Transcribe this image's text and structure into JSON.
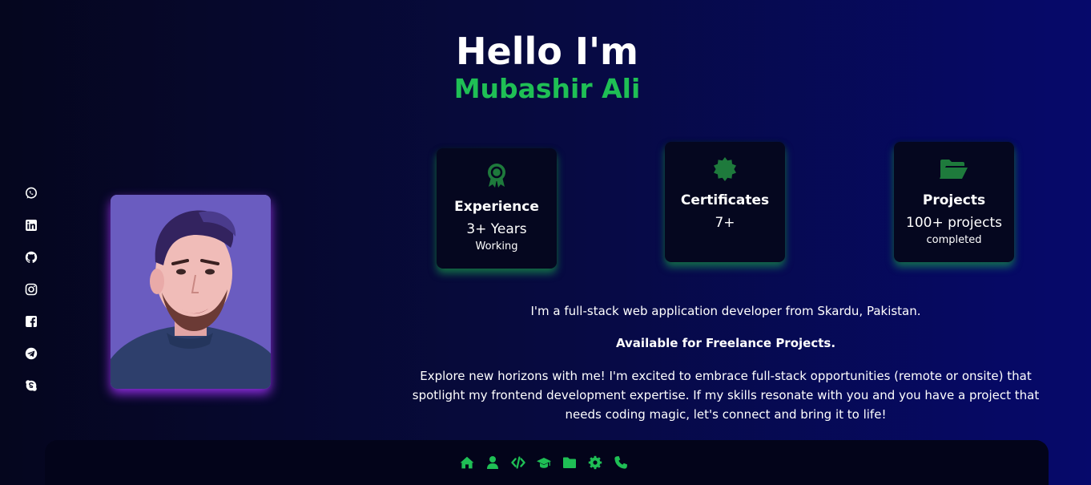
{
  "hero": {
    "greeting": "Hello I'm",
    "name": "Mubashir Ali"
  },
  "social_links": [
    {
      "icon": "whatsapp-icon"
    },
    {
      "icon": "linkedin-icon"
    },
    {
      "icon": "github-icon"
    },
    {
      "icon": "instagram-icon"
    },
    {
      "icon": "facebook-icon"
    },
    {
      "icon": "telegram-icon"
    },
    {
      "icon": "skype-icon"
    }
  ],
  "stats": [
    {
      "icon": "award-icon",
      "title": "Experience",
      "value": "3+ Years",
      "sub": "Working"
    },
    {
      "icon": "certificate-icon",
      "title": "Certificates",
      "value": "7+",
      "sub": ""
    },
    {
      "icon": "folder-open-icon",
      "title": "Projects",
      "value": "100+ projects",
      "sub": "completed"
    }
  ],
  "about": {
    "intro": "I'm a full-stack web application developer from Skardu, Pakistan.",
    "availability": "Available for Freelance Projects.",
    "description": "Explore new horizons with me! I'm excited to embrace full-stack opportunities (remote or onsite) that spotlight my frontend development expertise. If my skills resonate with you and you have a project that needs coding magic, let's connect and bring it to life!"
  },
  "nav": [
    {
      "icon": "home-icon"
    },
    {
      "icon": "user-icon"
    },
    {
      "icon": "code-icon"
    },
    {
      "icon": "graduation-cap-icon"
    },
    {
      "icon": "folder-icon"
    },
    {
      "icon": "gear-icon"
    },
    {
      "icon": "phone-icon"
    }
  ],
  "colors": {
    "accent": "#1fbf55",
    "background_start": "#05061e",
    "background_end": "#06096b",
    "card_bg": "#05071f",
    "avatar_glow": "#a834ff"
  }
}
